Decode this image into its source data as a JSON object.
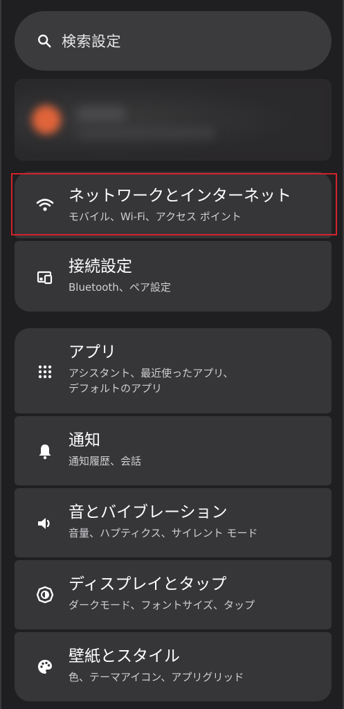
{
  "search": {
    "placeholder": "検索設定",
    "icon": "search-icon"
  },
  "groups": [
    {
      "items": [
        {
          "title": "ネットワークとインターネット",
          "subtitle": "モバイル、Wi-Fi、アクセス ポイント",
          "icon": "wifi-icon"
        },
        {
          "title": "接続設定",
          "subtitle": "Bluetooth、ペア設定",
          "icon": "connected-devices-icon"
        }
      ]
    },
    {
      "items": [
        {
          "title": "アプリ",
          "subtitle_lines": [
            "アシスタント、最近使ったアプリ、",
            "デフォルトのアプリ"
          ],
          "icon": "apps-grid-icon"
        },
        {
          "title": "通知",
          "subtitle": "通知履歴、会話",
          "icon": "bell-icon"
        },
        {
          "title": "音とバイブレーション",
          "subtitle": "音量、ハプティクス、サイレント モード",
          "icon": "speaker-icon"
        },
        {
          "title": "ディスプレイとタップ",
          "subtitle": "ダークモード、フォントサイズ、タップ",
          "icon": "brightness-icon"
        },
        {
          "title": "壁紙とスタイル",
          "subtitle": "色、テーマアイコン、アプリグリッド",
          "icon": "palette-icon"
        }
      ]
    }
  ],
  "colors": {
    "background": "#1f1f21",
    "card": "#363538",
    "search": "#3b3a3d",
    "highlight": "#d3232a",
    "avatar": "#e0643a"
  }
}
